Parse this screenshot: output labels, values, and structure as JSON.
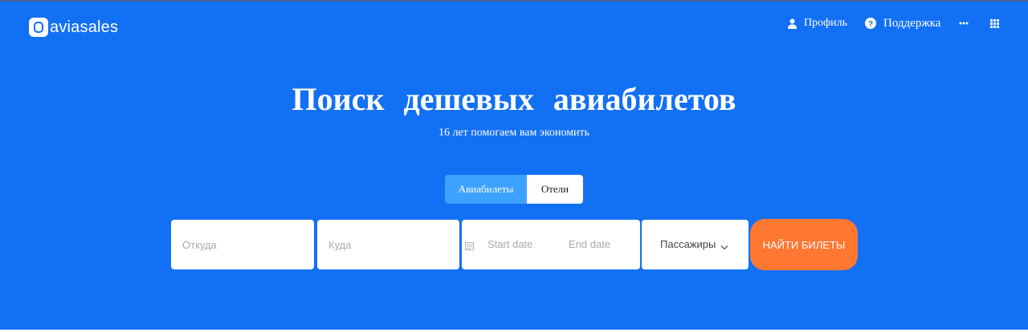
{
  "header": {
    "logo_text": "aviasales",
    "nav": {
      "profile": "Профиль",
      "support": "Поддержка"
    }
  },
  "hero": {
    "title": "Поиск дешевых авиабилетов",
    "subtitle": "16 лет помогаем вам экономить"
  },
  "tabs": [
    {
      "label": "Авиабилеты",
      "active": true
    },
    {
      "label": "Отели",
      "active": false
    }
  ],
  "search": {
    "from_placeholder": "Откуда",
    "to_placeholder": "Куда",
    "start_date": "Start date",
    "end_date": "End date",
    "passengers": "Пассажиры",
    "submit": "НАЙТИ БИЛЕТЫ"
  },
  "colors": {
    "background": "#1270f5",
    "active_tab": "#3da1ff",
    "search_button": "#ff7731"
  },
  "icons": [
    "person-icon",
    "question-icon",
    "more-dots-icon",
    "apps-grid-icon",
    "calendar-icon",
    "chevron-down-icon"
  ]
}
